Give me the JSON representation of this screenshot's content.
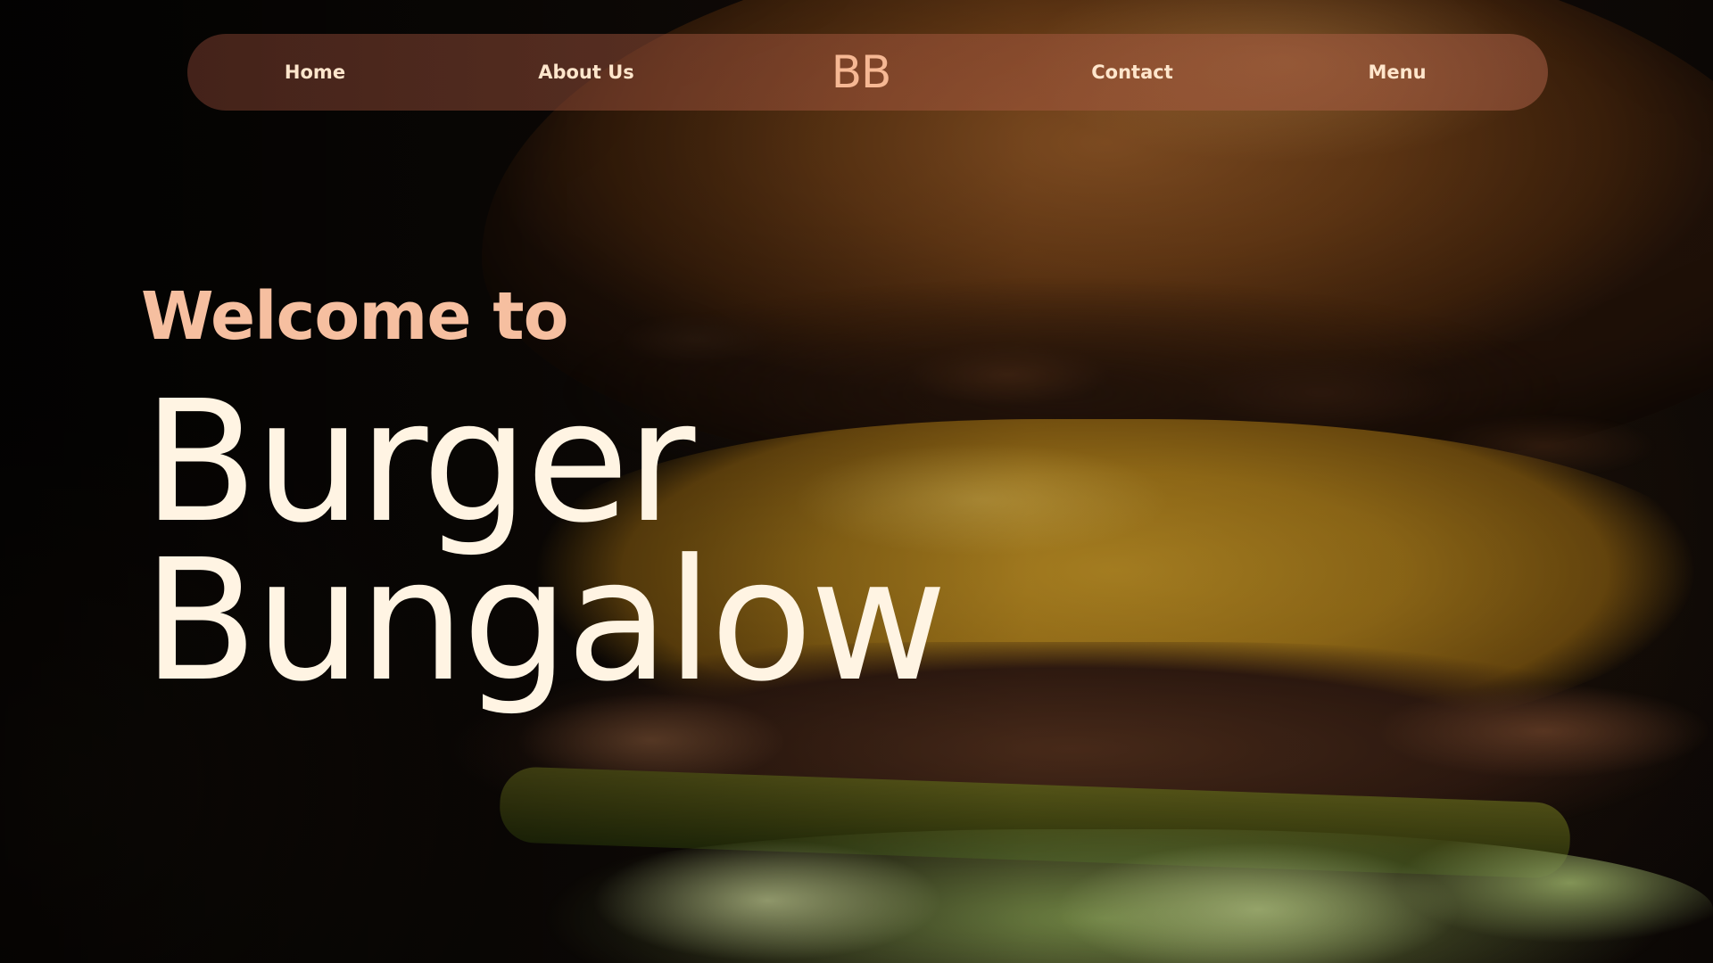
{
  "nav": {
    "home_label": "Home",
    "about_label": "About Us",
    "logo_text": "BB",
    "contact_label": "Contact",
    "menu_label": "Menu"
  },
  "hero": {
    "welcome_text": "Welcome to",
    "title_line1": "Burger",
    "title_line2": "Bungalow"
  },
  "colors": {
    "nav_text": "#ffe6cc",
    "logo": "#f6b894",
    "welcome": "#f6bfa0",
    "title": "#fff4e3"
  }
}
